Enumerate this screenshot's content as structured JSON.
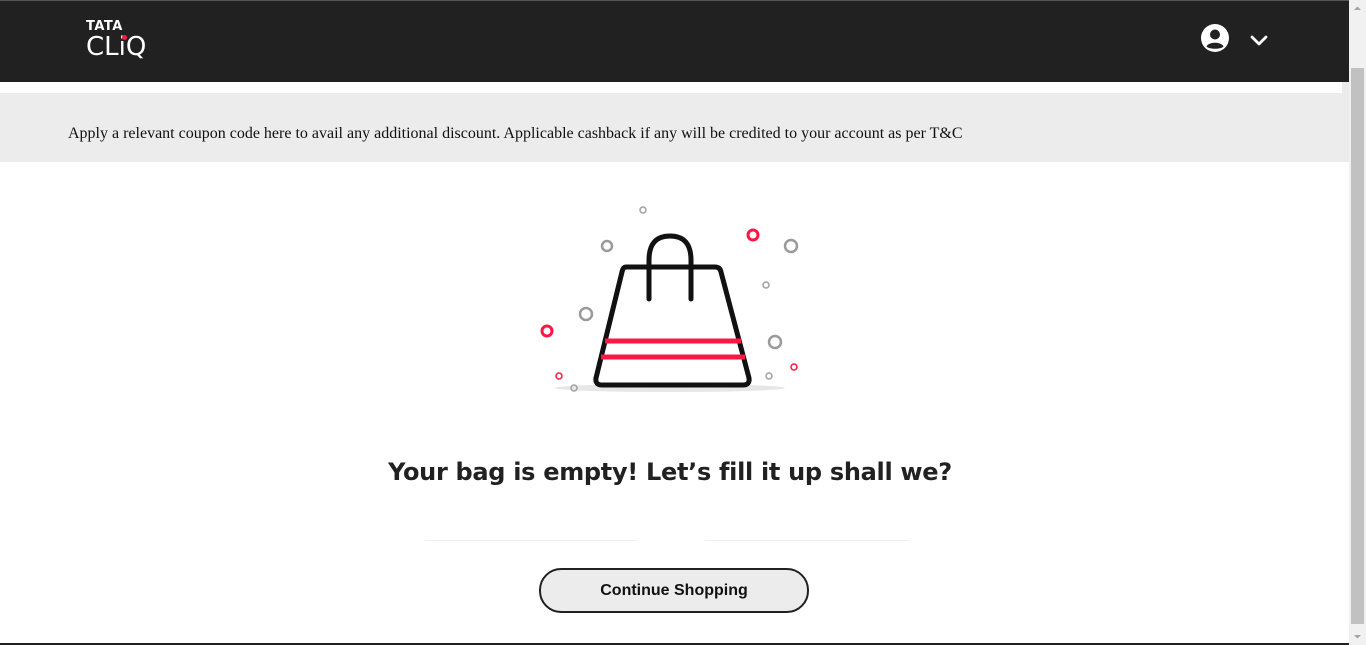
{
  "header": {
    "logo": {
      "top": "TATA",
      "bottom": "CLiQ"
    },
    "account_icon": "user-circle-icon",
    "dropdown_icon": "chevron-down-icon"
  },
  "coupon_banner": {
    "text": "Apply a relevant coupon code here to avail any additional discount. Applicable cashback if any will be credited to your account as per T&C"
  },
  "empty_bag": {
    "illustration": "shopping-bag-icon",
    "title": "Your bag is empty! Let’s fill it up shall we?",
    "continue_label": "Continue Shopping"
  },
  "colors": {
    "header_bg": "#212121",
    "banner_bg": "#ececec",
    "accent": "#ff1744",
    "button_bg": "#ececec"
  }
}
